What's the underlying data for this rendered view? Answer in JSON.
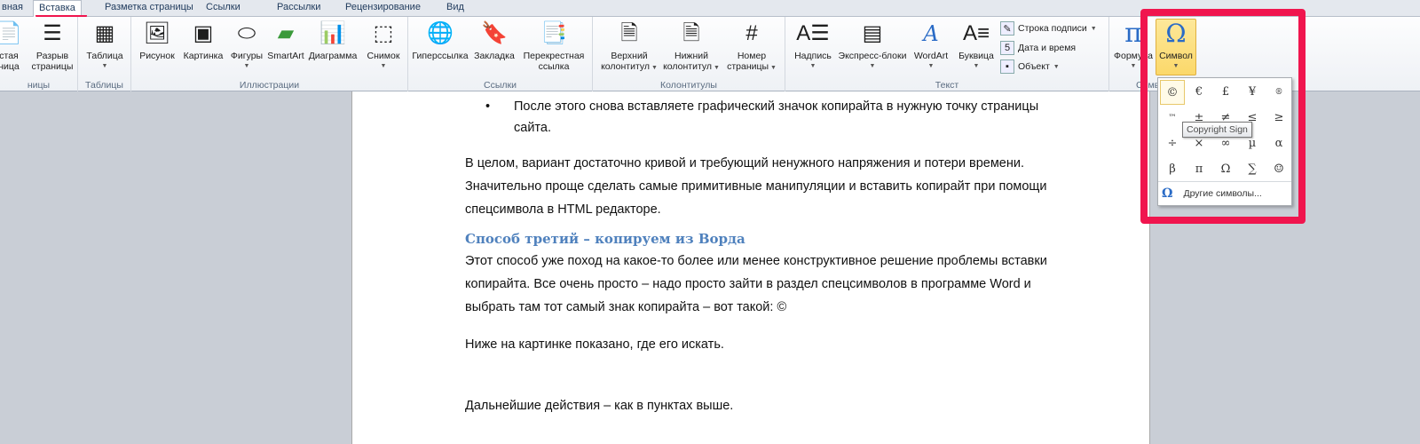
{
  "tabs": [
    {
      "label": "вная"
    },
    {
      "label": "Вставка",
      "active": true
    },
    {
      "label": "Разметка страницы"
    },
    {
      "label": "Ссылки"
    },
    {
      "label": "Рассылки"
    },
    {
      "label": "Рецензирование"
    },
    {
      "label": "Вид"
    }
  ],
  "ribbon": {
    "groups": {
      "pages": "ницы",
      "tables": "Таблицы",
      "illustrations": "Иллюстрации",
      "links": "Ссылки",
      "headers": "Колонтитулы",
      "text": "Текст",
      "symbols": "Симв"
    },
    "pages": [
      {
        "l1": "стая",
        "l2": "ница"
      },
      {
        "l1": "Разрыв",
        "l2": "страницы"
      }
    ],
    "table": "Таблица",
    "illustrations": [
      "Рисунок",
      "Картинка",
      "Фигуры",
      "SmartArt",
      "Диаграмма",
      "Снимок"
    ],
    "links": {
      "hyperlink": "Гиперссылка",
      "bookmark": "Закладка",
      "cross1": "Перекрестная",
      "cross2": "ссылка"
    },
    "headers": [
      {
        "l1": "Верхний",
        "l2": "колонтитул"
      },
      {
        "l1": "Нижний",
        "l2": "колонтитул"
      },
      {
        "l1": "Номер",
        "l2": "страницы"
      }
    ],
    "text": [
      "Надпись",
      "Экспресс-блоки",
      "WordArt",
      "Буквица"
    ],
    "text_small": [
      "Строка подписи",
      "Дата и время",
      "Объект"
    ],
    "formula": "Формула",
    "symbol": "Символ"
  },
  "symbol_menu": {
    "symbols": [
      "©",
      "€",
      "£",
      "¥",
      "®",
      "™",
      "±",
      "≠",
      "≤",
      "≥",
      "÷",
      "×",
      "∞",
      "µ",
      "α",
      "β",
      "π",
      "Ω",
      "∑",
      "☺"
    ],
    "tooltip": "Copyright Sign",
    "more_symbols": "Другие символы..."
  },
  "document": {
    "bullet_line1": "После этого снова вставляете графический значок копирайта в нужную точку страницы",
    "bullet_line2": "сайта.",
    "para1": [
      "В целом, вариант достаточно кривой и требующий ненужного напряжения и потери времени.",
      "Значительно проще сделать самые примитивные манипуляции и вставить копирайт при помощи",
      "спецсимвола в HTML редакторе."
    ],
    "heading": "Способ третий – копируем из Ворда",
    "para2": [
      "Этот способ уже поход на какое-то более или менее конструктивное решение проблемы вставки",
      "копирайта. Все очень просто – надо просто зайти в раздел спецсимволов в программе Word и",
      "выбрать там тот самый знак копирайта – вот такой: ©"
    ],
    "para3": "Ниже на картинке показано, где его искать.",
    "para4": "Дальнейшие действия – как в пунктах выше."
  },
  "colors": {
    "highlight": "#f0154e",
    "heading": "#4f81bd",
    "symbol_active": "#fbd86a"
  }
}
